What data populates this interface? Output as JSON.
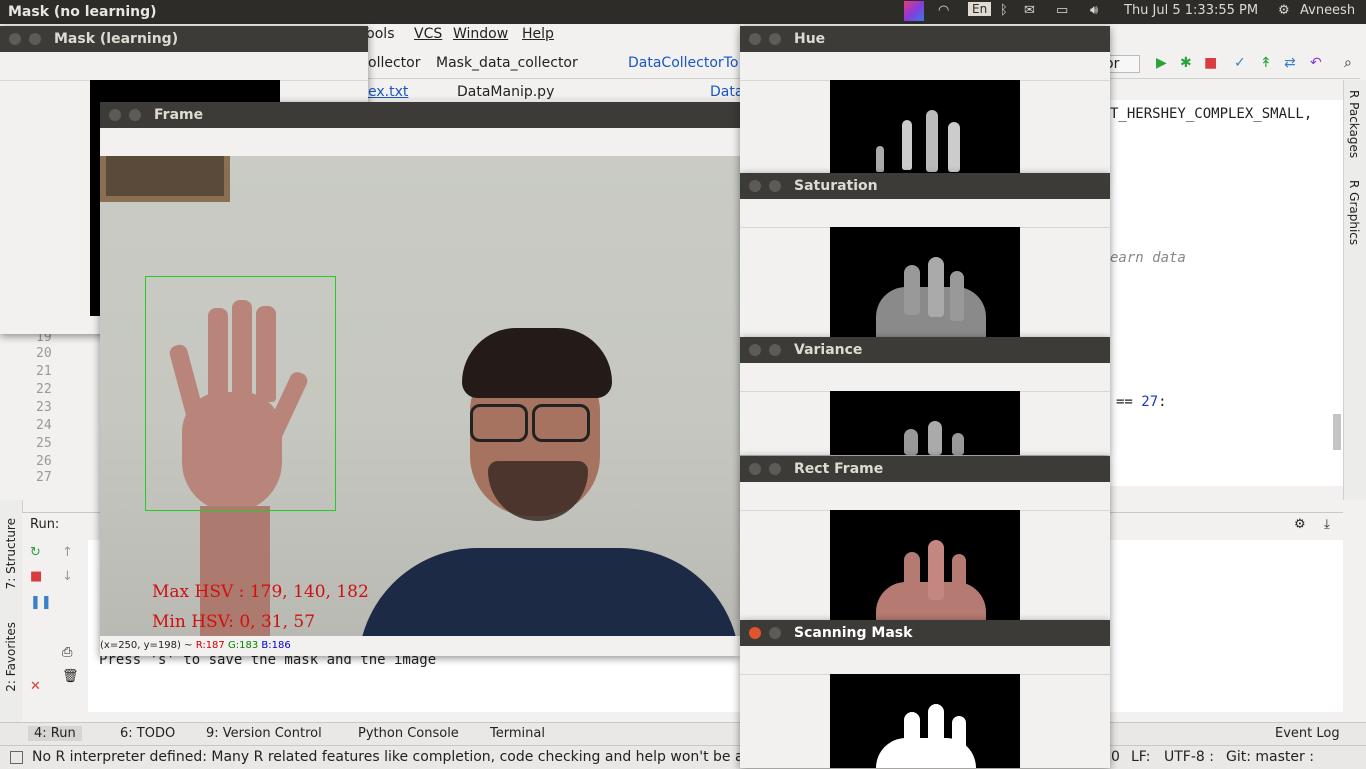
{
  "topbar": {
    "window_title": "Mask (no learning)",
    "keyboard": "En",
    "datetime": "Thu Jul 5  1:33:55 PM",
    "user": "Avneesh"
  },
  "ide": {
    "menu": [
      "Tools",
      "VCS",
      "Window",
      "Help"
    ],
    "breadcrumbs": [
      "ollector",
      "Mask_data_collector",
      "DataCollectorTo"
    ],
    "tabs": [
      "ex.txt",
      "DataManip.py",
      "Data"
    ],
    "run_config": "or",
    "code_snippets": {
      "line_top": "T_HERSHEY_COMPLEX_SMALL,",
      "comment": "earn data",
      "compare": "== ",
      "compare_value": "27",
      "compare_tail": ":"
    },
    "line_numbers": [
      "19",
      "20",
      "21",
      "22",
      "23",
      "24",
      "25",
      "26",
      "27"
    ],
    "right_panels": [
      "R Packages",
      "R Graphics"
    ],
    "left_panels": [
      "7: Structure",
      "2: Favorites"
    ],
    "run_label": "Run:",
    "console_output": "Press 's' to save the mask and the image",
    "bottom_tabs": [
      "4: Run",
      "6: TODO",
      "9: Version Control",
      "Python Console",
      "Terminal"
    ],
    "event_log": "Event Log",
    "status_message": "No R interpreter defined: Many R related features like completion, code checking and help won't be avail",
    "status_right": {
      "col": "0",
      "line_sep": "LF:",
      "encoding": "UTF-8 :",
      "git": "Git: master :"
    }
  },
  "windows": {
    "mask_learning": {
      "title": "Mask (learning)"
    },
    "frame": {
      "title": "Frame",
      "overlay_max": "Max HSV : 179, 140, 182",
      "overlay_min": "Min HSV: 0, 31, 57",
      "pixel_info": "(x=250, y=198) ~",
      "r": "R:187",
      "g": "G:183",
      "b": "B:186"
    },
    "hue": {
      "title": "Hue"
    },
    "saturation": {
      "title": "Saturation"
    },
    "variance": {
      "title": "Variance"
    },
    "rect_frame": {
      "title": "Rect Frame"
    },
    "scanning_mask": {
      "title": "Scanning Mask"
    }
  },
  "colors": {
    "overlay_text": "#d01010",
    "roi_box": "#22cc22",
    "link_blue": "#1a56c4"
  }
}
